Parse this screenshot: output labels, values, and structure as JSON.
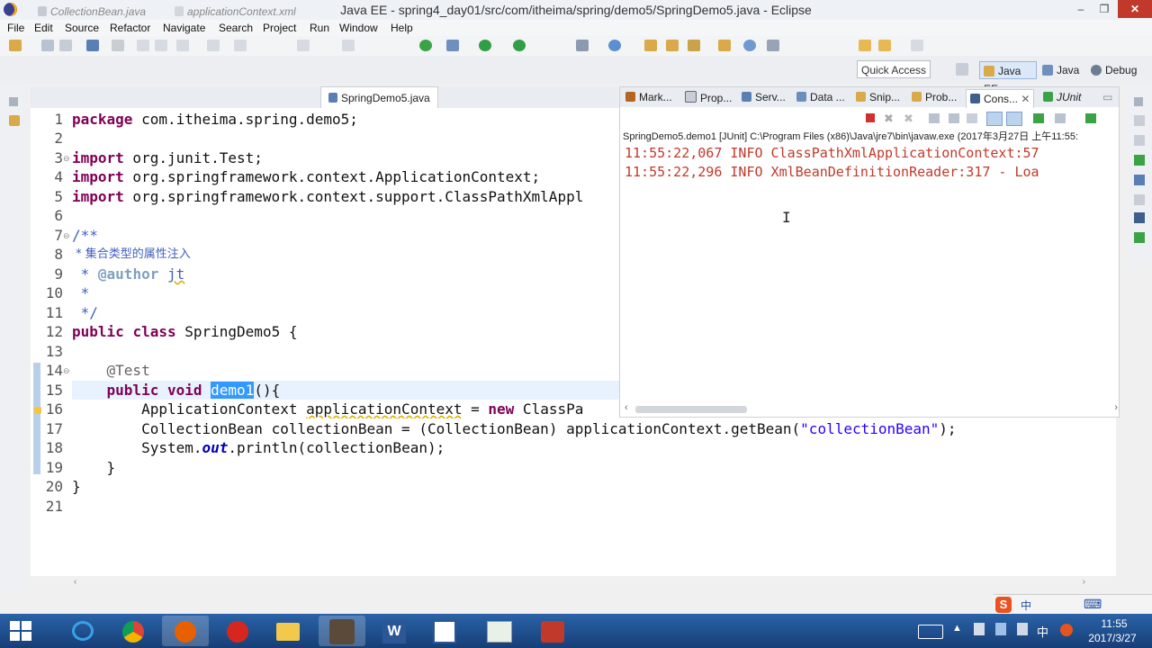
{
  "window": {
    "title": "Java EE - spring4_day01/src/com/itheima/spring/demo5/SpringDemo5.java - Eclipse",
    "controls": [
      "–",
      "❐",
      "✕"
    ]
  },
  "menu": [
    "File",
    "Edit",
    "Source",
    "Refactor",
    "Navigate",
    "Search",
    "Project",
    "Run",
    "Window",
    "Help"
  ],
  "perspectives": {
    "quick_access": "Quick Access",
    "items": [
      "Java EE",
      "Java",
      "Debug"
    ]
  },
  "editor": {
    "tabs": [
      "CollectionBean.java",
      "applicationContext.xml",
      "SpringDemo5.java"
    ],
    "active_tab": 2,
    "line_numbers": [
      "1",
      "2",
      "3",
      "4",
      "5",
      "6",
      "7",
      "8",
      "9",
      "10",
      "11",
      "12",
      "13",
      "14",
      "15",
      "16",
      "17",
      "18",
      "19",
      "20",
      "21"
    ],
    "code": {
      "l1_kw": "package",
      "l1_rest": " com.itheima.spring.demo5;",
      "l3_kw": "import",
      "l3_rest": " org.junit.Test;",
      "l4_kw": "import",
      "l4_rest": " org.springframework.context.ApplicationContext;",
      "l5_kw": "import",
      "l5_rest": " org.springframework.context.support.ClassPathXmlAppl",
      "l7": "/**",
      "l8": " * 集合类型的属性注入",
      "l9_pre": " * ",
      "l9_tag": "@author",
      "l9_sp": " ",
      "l9_name": "jt",
      "l10": " *",
      "l11": " */",
      "l12_kw1": "public",
      "l12_kw2": "class",
      "l12_rest": " SpringDemo5 {",
      "l14": "    @Test",
      "l15_kw1": "public",
      "l15_kw2": "void",
      "l15_sel": "demo1",
      "l15_rest": "(){",
      "l16_type": "        ApplicationContext ",
      "l16_var": "applicationContext",
      "l16_eq": " = ",
      "l16_kw": "new",
      "l16_rest": " ClassPa",
      "l17_type": "        CollectionBean ",
      "l17_var": "collectionBean",
      "l17_mid": " = (CollectionBean) ",
      "l17_var2": "applicationContext",
      "l17_call": ".getBean(",
      "l17_str": "\"collectionBean\"",
      "l17_end": ");",
      "l18_pre": "        System.",
      "l18_out": "out",
      "l18_rest": ".println(collectionBean);",
      "l19": "    }",
      "l20": "}"
    }
  },
  "console": {
    "tabs": [
      "Mark...",
      "Prop...",
      "Serv...",
      "Data ...",
      "Snip...",
      "Prob...",
      "Cons...",
      "JUnit"
    ],
    "description": "SpringDemo5.demo1 [JUnit] C:\\Program Files (x86)\\Java\\jre7\\bin\\javaw.exe (2017年3月27日 上午11:55:",
    "lines": [
      "11:55:22,067  INFO ClassPathXmlApplicationContext:57",
      "11:55:22,296  INFO XmlBeanDefinitionReader:317 - Loa"
    ]
  },
  "taskbar": {
    "time": "11:55",
    "date": "2017/3/27",
    "ime": [
      "中",
      "⌨"
    ]
  },
  "colors": {
    "keyword": "#7f0055",
    "string": "#2a00ff",
    "console_text": "#c0392b",
    "selection": "#3399ff",
    "taskbar": "#1d4f8f"
  }
}
